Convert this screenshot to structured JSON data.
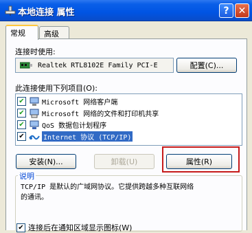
{
  "window": {
    "title": "本地连接 属性"
  },
  "tabs": [
    "常规",
    "高级"
  ],
  "connect_using": {
    "label": "连接时使用:",
    "adapter": "Realtek RTL8102E Family PCI-E",
    "configure_button": "配置(C)..."
  },
  "components": {
    "label": "此连接使用下列项目(O):",
    "items": [
      {
        "label": "Microsoft 网络客户端",
        "checked": true,
        "icon": "network-client-icon"
      },
      {
        "label": "Microsoft 网络的文件和打印机共享",
        "checked": true,
        "icon": "printer-share-icon"
      },
      {
        "label": "QoS 数据包计划程序",
        "checked": true,
        "icon": "qos-icon"
      },
      {
        "label": "Internet 协议 (TCP/IP)",
        "checked": true,
        "icon": "protocol-icon",
        "selected": true
      }
    ]
  },
  "buttons": {
    "install": "安装(N)...",
    "uninstall": "卸载(U)",
    "properties": "属性(R)"
  },
  "description": {
    "title": "说明",
    "line1": "TCP/IP 是默认的广域网协议。它提供跨越多种互联网络",
    "line2": "的通讯。"
  },
  "notify_checkbox": {
    "label": "连接后在通知区域显示图标(W)",
    "checked": true
  },
  "colors": {
    "title_bar": "#0054E3",
    "highlight_frame": "#C61A1A",
    "selection": "#316AC5"
  }
}
